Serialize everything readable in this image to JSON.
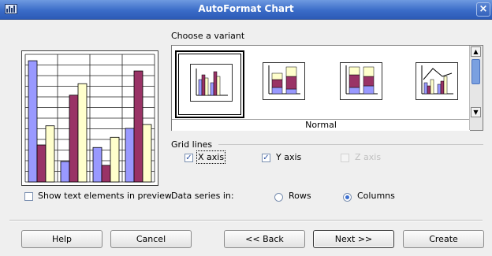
{
  "window": {
    "title": "AutoFormat Chart",
    "close_glyph": "×"
  },
  "choose_variant_label": "Choose a variant",
  "variants": [
    {
      "icon": "bar-chart-normal-icon"
    },
    {
      "icon": "bar-chart-stacked-icon"
    },
    {
      "icon": "bar-chart-percent-stacked-icon"
    },
    {
      "icon": "bar-chart-with-lines-icon"
    }
  ],
  "selected_variant_name": "Normal",
  "preview_checkbox": {
    "label": "Show text elements in preview",
    "checked": false
  },
  "grid_lines": {
    "label": "Grid lines",
    "x_axis": {
      "label": "X axis",
      "checked": true
    },
    "y_axis": {
      "label": "Y axis",
      "checked": true
    },
    "z_axis": {
      "label": "Z axis",
      "checked": false,
      "disabled": true
    }
  },
  "data_series": {
    "label": "Data series in:",
    "rows": {
      "label": "Rows",
      "selected": false
    },
    "columns": {
      "label": "Columns",
      "selected": true
    }
  },
  "buttons": {
    "help": "Help",
    "cancel": "Cancel",
    "back": "<< Back",
    "next": "Next >>",
    "create": "Create"
  },
  "preview_chart": {
    "series_colors": [
      "#9999ff",
      "#993366",
      "#ffffcc"
    ],
    "groups": [
      [
        95,
        29,
        44
      ],
      [
        16,
        68,
        77
      ],
      [
        27,
        13,
        35
      ],
      [
        42,
        87,
        45
      ]
    ],
    "ymax": 100
  }
}
